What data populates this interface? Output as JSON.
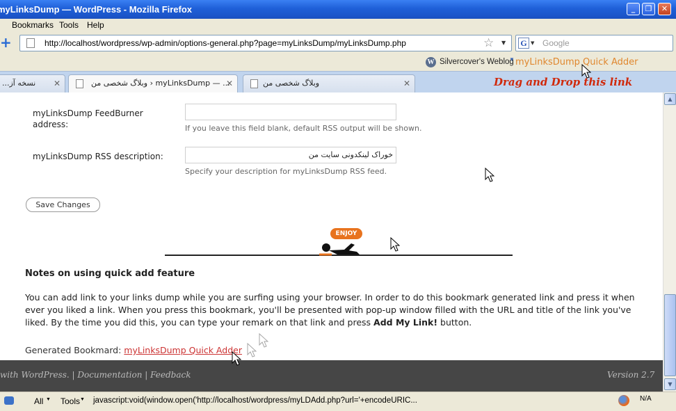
{
  "window": {
    "title": "myLinksDump — WordPress - Mozilla Firefox",
    "controls": [
      "_",
      "❐",
      "✕"
    ]
  },
  "menu": {
    "items": [
      "Bookmarks",
      "Tools",
      "Help"
    ]
  },
  "nav": {
    "url": "http://localhost/wordpress/wp-admin/options-general.php?page=myLinksDump/myLinksDump.php",
    "search_placeholder": "Google"
  },
  "bookmarks": {
    "item1": "Silvercover's Weblog",
    "item2": "myLinksDump Quick Adder"
  },
  "tabs": [
    {
      "label": "نسخه آز..."
    },
    {
      "label": "وبلاگ شخصی من › myLinksDump — ..."
    },
    {
      "label": "وبلاگ شخصی من"
    }
  ],
  "overlay_text": "Drag and Drop this link",
  "form": {
    "feedburner_label": "myLinksDump FeedBurner address:",
    "feedburner_value": "",
    "feedburner_hint": "If you leave this field blank, default RSS output will be shown.",
    "rss_label": "myLinksDump RSS description:",
    "rss_value": "خوراک لینکدونی سایت من",
    "rss_hint": "Specify your description for myLinksDump RSS feed.",
    "save_label": "Save Changes"
  },
  "illustration": {
    "bubble": "ENJOY"
  },
  "notes": {
    "title": "Notes on using quick add feature",
    "body_part1": "You can add link to your links dump while you are surfing using your browser. In order to do this bookmark generated link and press it when ever you liked a link. When you press this bookmark, you'll be presented with pop-up window filled with the URL and title of the link you've liked. By the time you did this, you can type your remark on that link and press ",
    "body_bold": "Add My Link!",
    "body_part2": " button.",
    "generated_label": "Generated Bookmard:",
    "generated_link": "myLinksDump Quick Adder"
  },
  "footer": {
    "left": "with WordPress. | Documentation | Feedback",
    "right": "Version 2.7"
  },
  "status": {
    "all": "All",
    "tools": "Tools",
    "url": "javascript:void(window.open('http://localhost/wordpress/myLDAdd.php?url='+encodeURIC...",
    "na": "N/A"
  },
  "colors": {
    "titlebar": "#1f5fd8",
    "tab_bar": "#c0d4ee",
    "overlay_text": "#d02a0c",
    "link": "#cc3333",
    "footer_bg": "#464646",
    "enjoy_bubble": "#e8731e"
  }
}
